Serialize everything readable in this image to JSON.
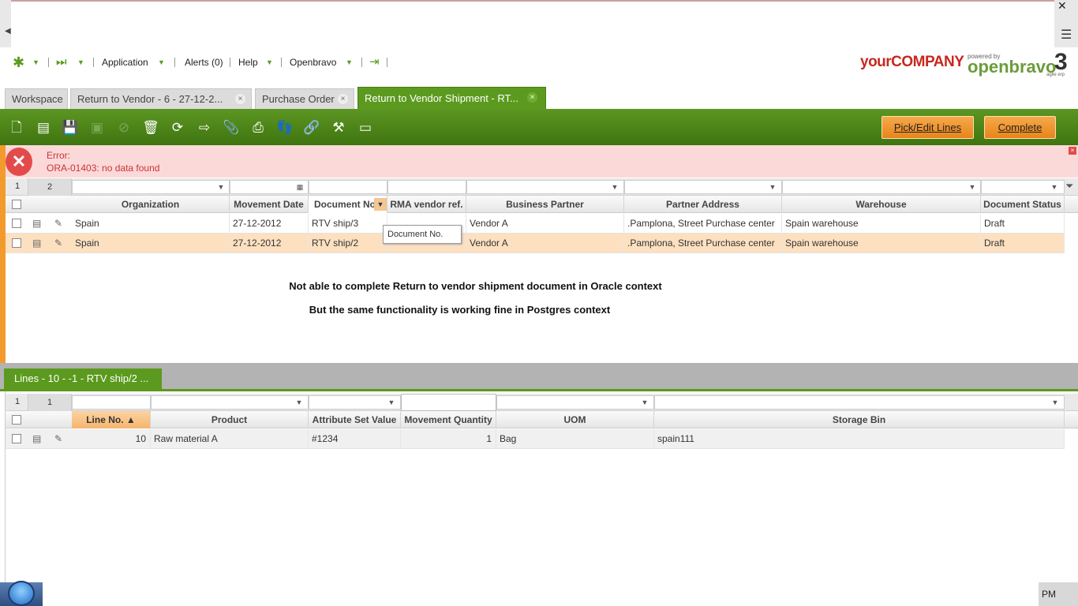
{
  "nav": {
    "application": "Application",
    "alerts": "Alerts (0)",
    "help": "Help",
    "openbravo": "Openbravo"
  },
  "brand": {
    "company": "yourCOMPANY",
    "powered_by": "powered by",
    "product": "openbravo",
    "product_version": "3",
    "tagline": "agile erp"
  },
  "tabs": [
    {
      "label": "Workspace"
    },
    {
      "label": "Return to Vendor - 6 - 27-12-2..."
    },
    {
      "label": "Purchase Order"
    },
    {
      "label": "Return to Vendor Shipment - RT..."
    }
  ],
  "toolbar": {
    "pick_edit_lines": "Pick/Edit Lines",
    "complete": "Complete"
  },
  "error": {
    "title": "Error:",
    "message": "ORA-01403: no data found"
  },
  "header_grid": {
    "selection": {
      "selected": "1",
      "total": "2"
    },
    "columns": [
      "Organization",
      "Movement Date",
      "Document No.",
      "RMA vendor ref.",
      "Business Partner",
      "Partner Address",
      "Warehouse",
      "Document Status"
    ],
    "rows": [
      {
        "org": "Spain",
        "date": "27-12-2012",
        "docno": "RTV ship/3",
        "rma": "",
        "bp": "Vendor A",
        "address": ".Pamplona, Street Purchase center",
        "warehouse": "Spain warehouse",
        "status": "Draft"
      },
      {
        "org": "Spain",
        "date": "27-12-2012",
        "docno": "RTV ship/2",
        "rma": "",
        "bp": "Vendor A",
        "address": ".Pamplona, Street Purchase center",
        "warehouse": "Spain warehouse",
        "status": "Draft"
      }
    ],
    "tooltip": "Document No.",
    "colors": {
      "selected_row": "#fde0c0"
    }
  },
  "notes": {
    "line1": "Not able to complete Return to vendor shipment document in Oracle context",
    "line2": "But the same functionality is working fine in Postgres context"
  },
  "lines": {
    "tab_label": "Lines - 10 - -1 - RTV ship/2 ...",
    "selection": {
      "selected": "1",
      "total": "1"
    },
    "columns": [
      "Line No. ▲",
      "Product",
      "Attribute Set Value",
      "Movement Quantity",
      "UOM",
      "Storage Bin"
    ],
    "rows": [
      {
        "line": "10",
        "product": "Raw material A",
        "attr": "#1234",
        "qty": "1",
        "uom": "Bag",
        "bin": "spain111"
      }
    ]
  },
  "system": {
    "clock": "PM"
  },
  "colors": {
    "accent_green": "#5b9a1e",
    "accent_orange": "#f39a2c",
    "error_bg": "#fbd9d9",
    "error_text": "#cc3333"
  }
}
